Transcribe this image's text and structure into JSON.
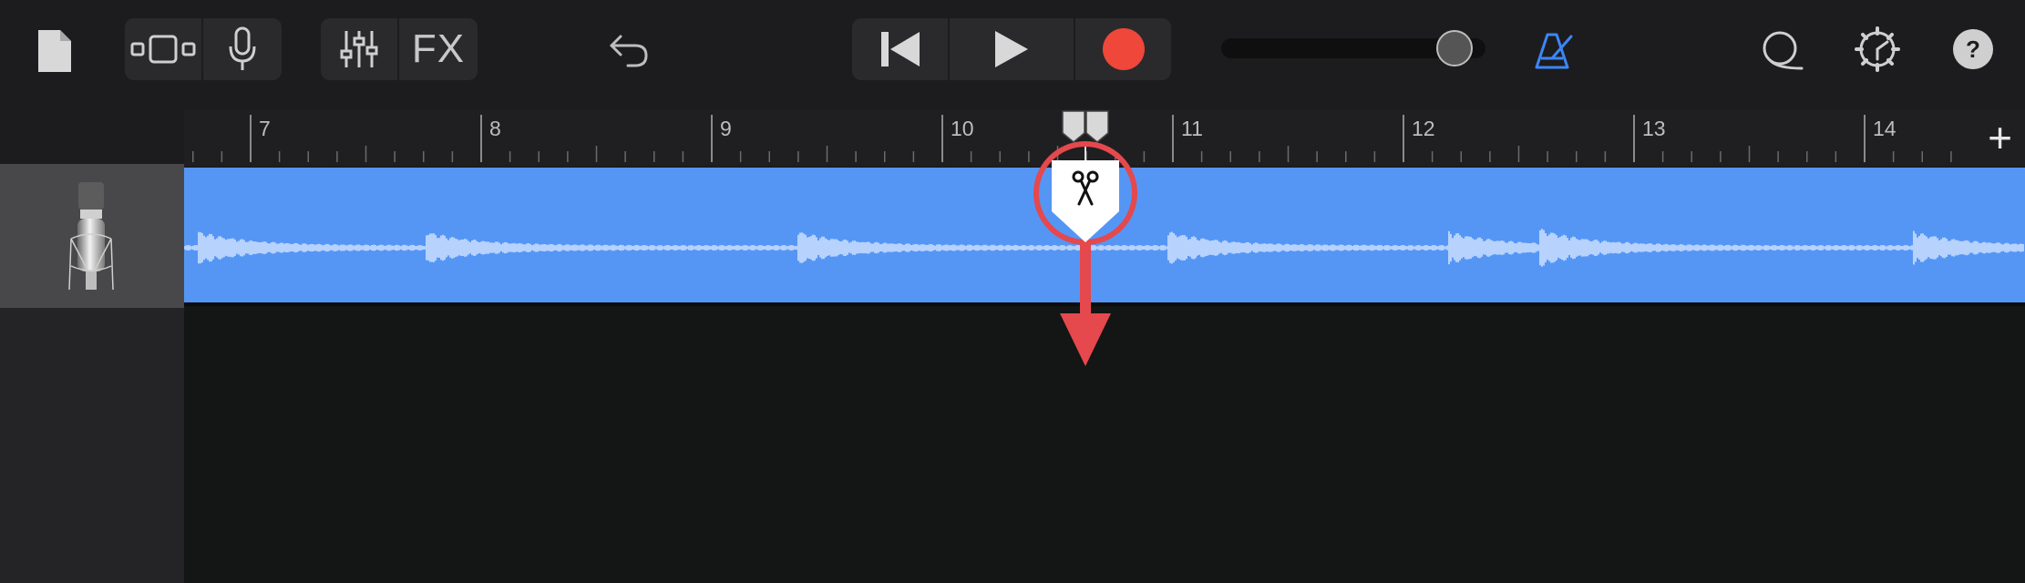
{
  "toolbar": {
    "left_buttons": [
      "document-icon",
      "track-view-icon",
      "microphone-icon"
    ],
    "fx_label": "FX",
    "icons": {
      "mixer": "sliders-icon",
      "undo": "undo-arrow-icon",
      "rewind": "skip-to-start-icon",
      "play": "play-icon",
      "record": "record-icon",
      "metronome": "metronome-icon",
      "loop": "loop-icon",
      "settings": "gear-icon",
      "help": "help-icon"
    },
    "volume_level": 0.9
  },
  "ruler": {
    "bars": [
      "7",
      "8",
      "9",
      "10",
      "11",
      "12",
      "13",
      "14"
    ]
  },
  "colors": {
    "region": "#5596f5",
    "record": "#ef473a",
    "accent": "#3c86f5",
    "callout": "#e5484d"
  }
}
